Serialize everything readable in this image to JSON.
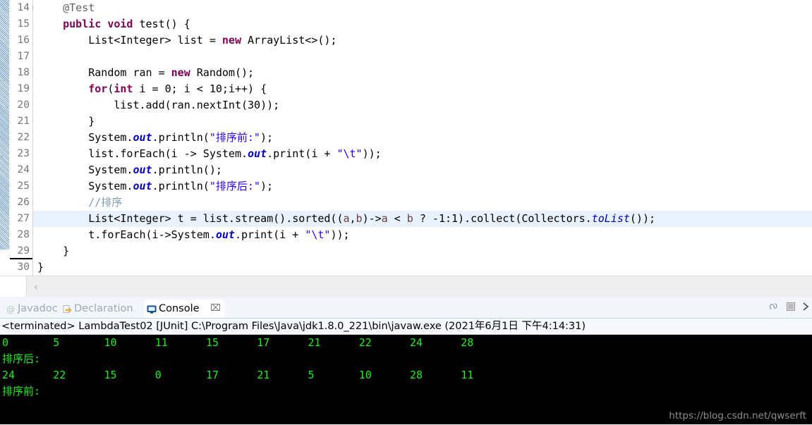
{
  "editor": {
    "lines": [
      {
        "num": "14",
        "folding": true,
        "highlight": false,
        "text": "    @Test"
      },
      {
        "num": "15",
        "folding": false,
        "highlight": false,
        "text": "    public void test() {"
      },
      {
        "num": "16",
        "folding": false,
        "highlight": false,
        "text": "        List<Integer> list = new ArrayList<>();"
      },
      {
        "num": "17",
        "folding": false,
        "highlight": false,
        "text": ""
      },
      {
        "num": "18",
        "folding": false,
        "highlight": false,
        "text": "        Random ran = new Random();"
      },
      {
        "num": "19",
        "folding": false,
        "highlight": false,
        "text": "        for(int i = 0; i < 10;i++) {"
      },
      {
        "num": "20",
        "folding": false,
        "highlight": false,
        "text": "            list.add(ran.nextInt(30));"
      },
      {
        "num": "21",
        "folding": false,
        "highlight": false,
        "text": "        }"
      },
      {
        "num": "22",
        "folding": false,
        "highlight": false,
        "text": "        System.out.println(\"排序前:\");"
      },
      {
        "num": "23",
        "folding": false,
        "highlight": false,
        "text": "        list.forEach(i -> System.out.print(i + \"\\t\"));"
      },
      {
        "num": "24",
        "folding": false,
        "highlight": false,
        "text": "        System.out.println();"
      },
      {
        "num": "25",
        "folding": false,
        "highlight": false,
        "text": "        System.out.println(\"排序后:\");"
      },
      {
        "num": "26",
        "folding": false,
        "highlight": false,
        "text": "        //排序"
      },
      {
        "num": "27",
        "folding": false,
        "highlight": true,
        "text": "        List<Integer> t = list.stream().sorted((a,b)->a < b ? -1:1).collect(Collectors.toList());"
      },
      {
        "num": "28",
        "folding": false,
        "highlight": false,
        "text": "        t.forEach(i->System.out.print(i + \"\\t\"));"
      },
      {
        "num": "29",
        "folding": false,
        "highlight": false,
        "text": "    }"
      },
      {
        "num": "30",
        "folding": false,
        "highlight": false,
        "text": "}"
      }
    ],
    "scrollbar_arrow": "‹"
  },
  "console_view": {
    "tabs": [
      {
        "label": "Javadoc",
        "icon": "at-icon",
        "active": false,
        "closable": false
      },
      {
        "label": "Declaration",
        "icon": "declaration-icon",
        "active": false,
        "closable": false
      },
      {
        "label": "Console",
        "icon": "console-icon",
        "active": true,
        "closable": true,
        "close_glyph": "⌧"
      }
    ],
    "toolbar_icons": [
      {
        "name": "pin-console-icon"
      },
      {
        "name": "stop-icon"
      },
      {
        "name": "display-selected-console-icon"
      }
    ],
    "terminated_line": "<terminated> LambdaTest02 [JUnit] C:\\Program Files\\Java\\jdk1.8.0_221\\bin\\javaw.exe (2021年6月1日 下午4:14:31)",
    "output": [
      {
        "text": "排序前:"
      },
      {
        "text": "24      22      15      0       17      21      5       10      28      11"
      },
      {
        "text": "排序后:"
      },
      {
        "text": "0       5       10      11      15      17      21      22      24      28"
      }
    ],
    "watermark": "https://blog.csdn.net/qwserft"
  },
  "colors": {
    "keyword": "#7f0055",
    "string": "#2a00ff",
    "comment": "#7f9fb0",
    "field": "#0000c0",
    "console_green": "#1aef1a",
    "highlight_row": "#e8f2fe"
  }
}
